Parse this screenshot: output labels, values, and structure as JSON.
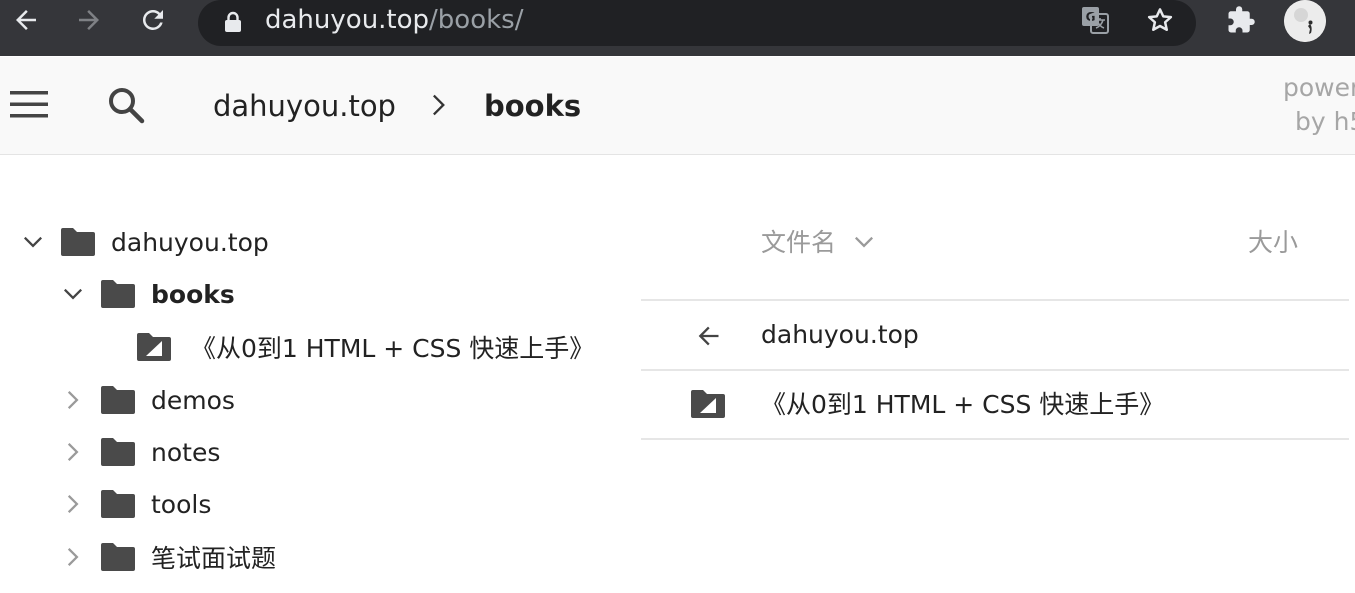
{
  "browser": {
    "url_host": "dahuyou.top",
    "url_path": "/books/"
  },
  "header": {
    "breadcrumb": [
      {
        "label": "dahuyou.top"
      },
      {
        "label": "books"
      }
    ],
    "powered_by": [
      "power",
      "by h5"
    ]
  },
  "tree": {
    "items": [
      {
        "label": "dahuyou.top",
        "expanded": true
      },
      {
        "label": "books",
        "expanded": true,
        "current": true
      },
      {
        "label": "《从0到1 HTML + CSS 快速上手》",
        "type": "link"
      },
      {
        "label": "demos",
        "expanded": false
      },
      {
        "label": "notes",
        "expanded": false
      },
      {
        "label": "tools",
        "expanded": false
      },
      {
        "label": "笔试面试题",
        "expanded": false
      }
    ]
  },
  "listing": {
    "columns": {
      "name": "文件名",
      "size": "大小"
    },
    "parent_link": "dahuyou.top",
    "rows": [
      {
        "name": "《从0到1 HTML + CSS 快速上手》",
        "type": "link"
      }
    ]
  },
  "colors": {
    "chrome_bg": "#35363a",
    "omnibox_bg": "#202124",
    "appbar_bg": "#f9f9f9",
    "icon_dark": "#444444",
    "muted_text": "#9a9a9a"
  }
}
